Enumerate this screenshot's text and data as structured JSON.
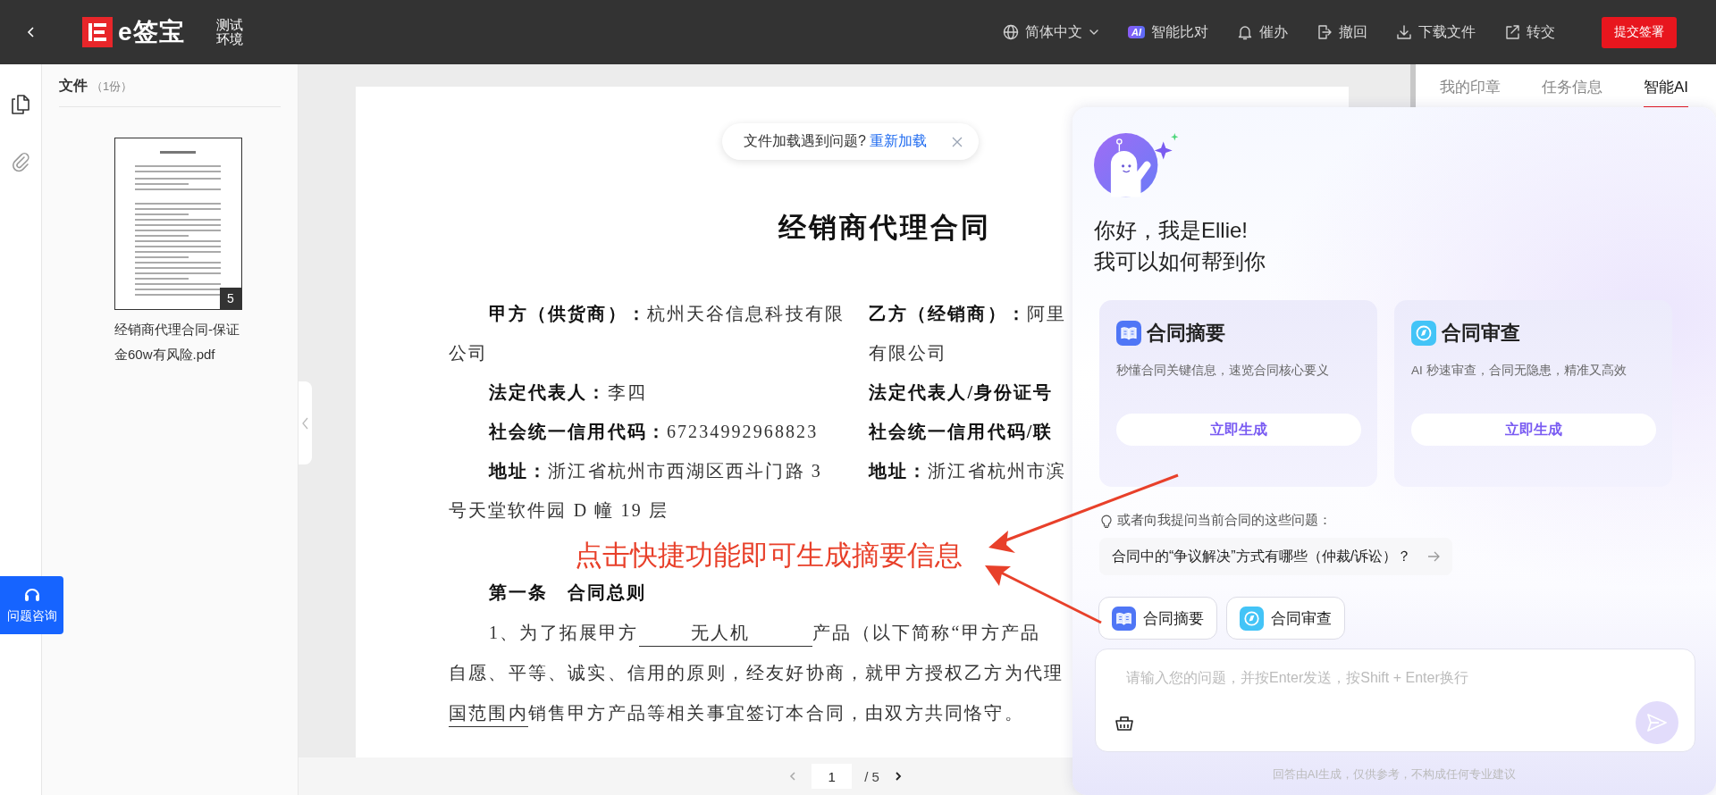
{
  "top_bar": {
    "brand": "e签宝",
    "env_badge": "测试环境",
    "actions": [
      {
        "kind": "language",
        "label": "简体中文"
      },
      {
        "kind": "ai",
        "badge": "AI",
        "label": "智能比对"
      },
      {
        "kind": "remind",
        "label": "催办"
      },
      {
        "kind": "withdraw",
        "label": "撤回"
      },
      {
        "kind": "download",
        "label": "下载文件"
      },
      {
        "kind": "transfer",
        "label": "转交"
      }
    ],
    "submit_button": "提交签署"
  },
  "left_rail": [
    {
      "kind": "files",
      "selected": true
    },
    {
      "kind": "attachments",
      "selected": false
    }
  ],
  "file_panel": {
    "title": "文件",
    "count": "（1份）",
    "files": [
      {
        "name": "经销商代理合同-保证金60w有风险.pdf",
        "pages": "5"
      }
    ]
  },
  "help_button": "问题咨询",
  "toast": {
    "message": "文件加载遇到问题?",
    "link": "重新加载"
  },
  "document": {
    "title": "经销商代理合同",
    "rows": [
      {
        "left": {
          "label": "甲方（供货商）：",
          "value": "杭州天谷信息科技有限"
        },
        "right": {
          "label": "乙方（经销商）：",
          "value": "阿里"
        }
      },
      {
        "left": {
          "value": "公司"
        },
        "right": {
          "value": "有限公司"
        }
      },
      {
        "left": {
          "label": "法定代表人：",
          "value": "李四"
        },
        "right": {
          "label": "法定代表人/身份证号"
        }
      },
      {
        "left": {
          "label": "社会统一信用代码：",
          "value": "67234992968823"
        },
        "right": {
          "label": "社会统一信用代码/联"
        }
      },
      {
        "left": {
          "label": "地址：",
          "value": "浙江省杭州市西湖区西斗门路 3"
        },
        "right": {
          "label": "地址：",
          "value": "浙江省杭州市滨"
        }
      },
      {
        "left": {
          "value": "号天堂软件园 D 幢 19 层"
        }
      }
    ],
    "article": {
      "heading": "第一条　合同总则",
      "lines": [
        {
          "indent": true,
          "parts": [
            {
              "kind": "text",
              "text": "1、为了拓展甲方"
            },
            {
              "kind": "blank",
              "text": "无人机"
            },
            {
              "kind": "text",
              "text": "产品（以下简称“甲方产品"
            }
          ]
        },
        {
          "indent": false,
          "parts": [
            {
              "kind": "text",
              "text": "自愿、平等、诚实、信用的原则，经友好协商，就甲方授权乙方为代理"
            }
          ]
        },
        {
          "indent": false,
          "parts": [
            {
              "kind": "blank",
              "text": "国范围内"
            },
            {
              "kind": "text",
              "text": "销售甲方产品等相关事宜签订本合同，由双方共同恪守。"
            }
          ]
        }
      ]
    }
  },
  "annotation": {
    "text": "点击快捷功能即可生成摘要信息"
  },
  "pagination": {
    "page": "1",
    "total": "/ 5",
    "prev_disabled": true
  },
  "side_tabs": [
    {
      "label": "我的印章",
      "selected": false
    },
    {
      "label": "任务信息",
      "selected": false
    },
    {
      "label": "智能AI",
      "selected": true
    }
  ],
  "ai_panel": {
    "greeting": "你好，我是Ellie!",
    "subtitle": "我可以如何帮到你",
    "cards": [
      {
        "kind": "summary",
        "title": "合同摘要",
        "description": "秒懂合同关键信息，速览合同核心要义",
        "button": "立即生成"
      },
      {
        "kind": "review",
        "title": "合同审查",
        "description": "AI 秒速审查，合同无隐患，精准又高效",
        "button": "立即生成"
      }
    ],
    "hint": "或者向我提问当前合同的这些问题：",
    "suggestions": [
      "合同中的“争议解决”方式有哪些（仲裁/诉讼）？"
    ],
    "quick_actions": [
      {
        "kind": "summary",
        "label": "合同摘要"
      },
      {
        "kind": "review",
        "label": "合同审查"
      }
    ],
    "input": {
      "placeholder": "请输入您的问题，并按Enter发送，按Shift + Enter换行"
    },
    "send_button": {
      "disabled": true
    },
    "disclaimer": "回答由AI生成，仅供参考，不构成任何专业建议"
  }
}
